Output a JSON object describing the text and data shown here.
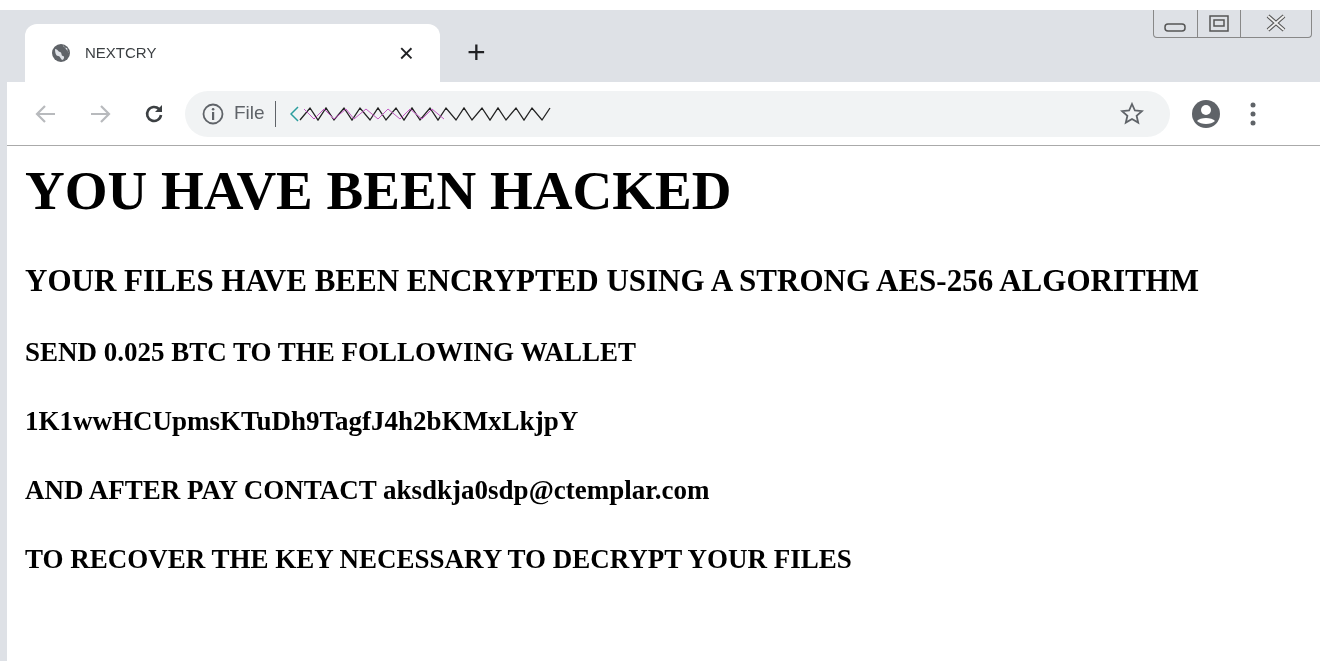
{
  "tab": {
    "title": "NEXTCRY",
    "close": "×",
    "selected": true
  },
  "new_tab": "+",
  "address_bar": {
    "scheme": "File"
  },
  "page": {
    "heading": "YOU HAVE BEEN HACKED",
    "lines": [
      {
        "kind": "subheading",
        "text": "YOUR FILES HAVE BEEN ENCRYPTED USING A STRONG AES-256 ALGORITHM"
      },
      {
        "kind": "line",
        "text": "SEND 0.025 BTC TO THE FOLLOWING WALLET"
      },
      {
        "kind": "line",
        "text": "1K1wwHCUpmsKTuDh9TagfJ4h2bKMxLkjpY"
      },
      {
        "kind": "line",
        "text": "AND AFTER PAY CONTACT aksdkja0sdp@ctemplar.com"
      },
      {
        "kind": "line",
        "text": "TO RECOVER THE KEY NECESSARY TO DECRYPT YOUR FILES"
      }
    ]
  }
}
